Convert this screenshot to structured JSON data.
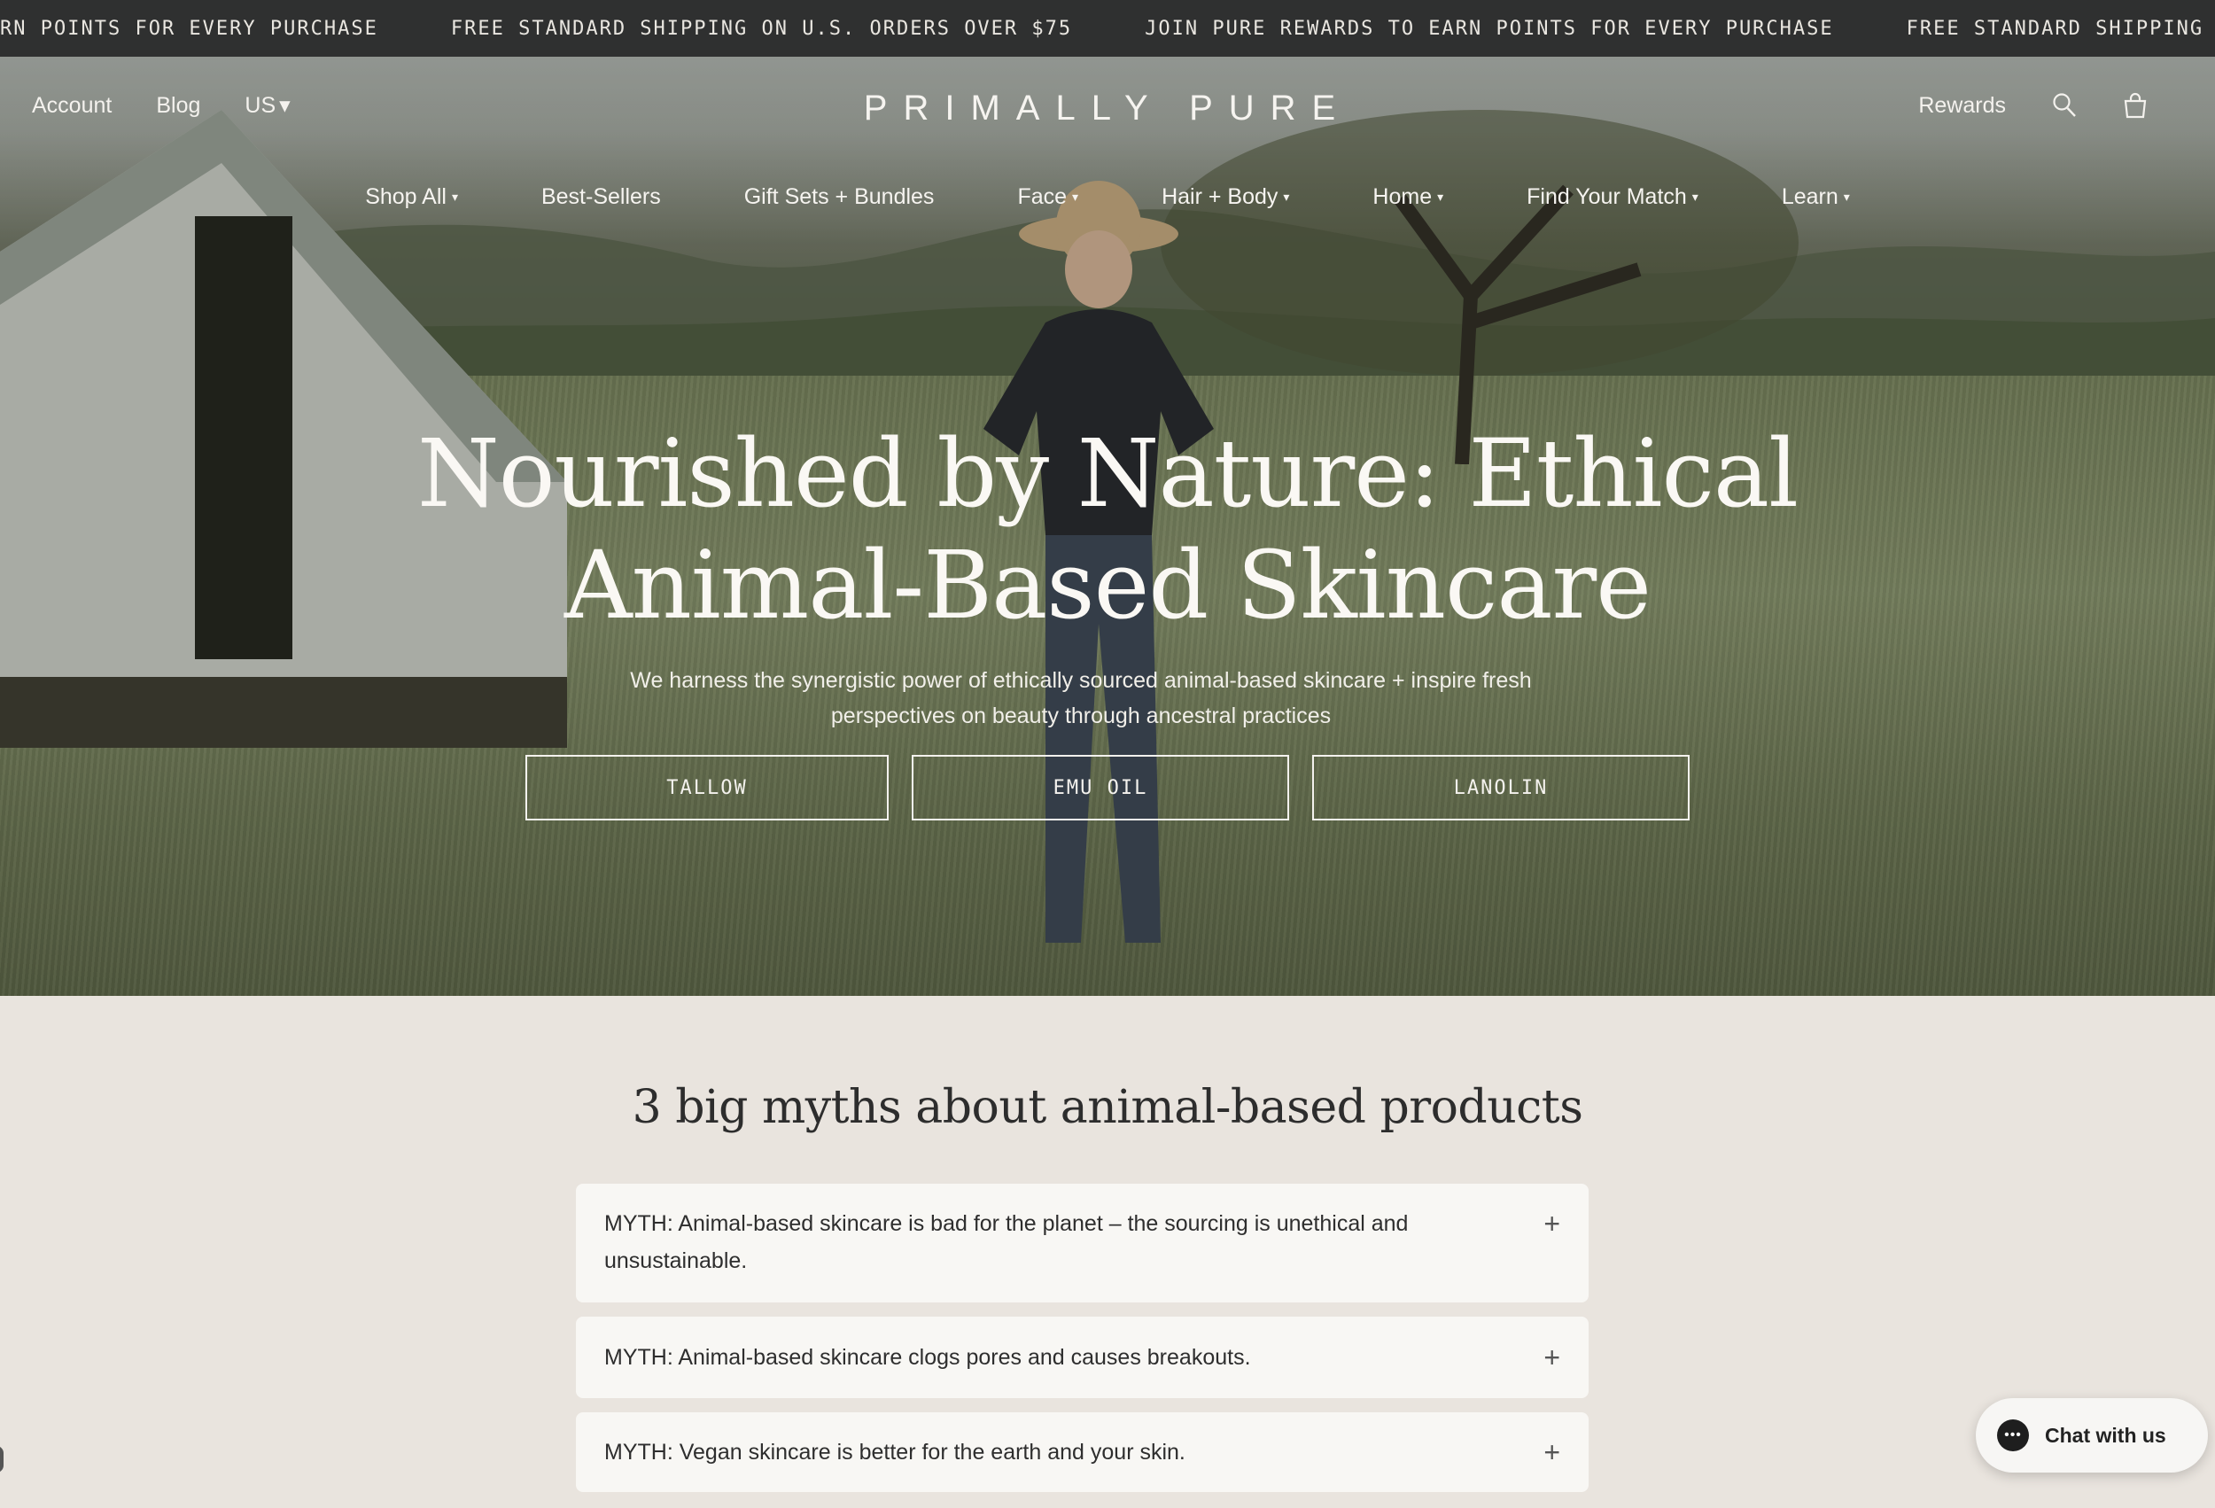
{
  "announcement": {
    "messages": [
      "RN POINTS FOR EVERY PURCHASE",
      "FREE STANDARD SHIPPING ON U.S. ORDERS OVER $75",
      "JOIN PURE REWARDS TO EARN POINTS FOR EVERY PURCHASE",
      "FREE STANDARD SHIPPING O"
    ]
  },
  "header": {
    "account": "Account",
    "blog": "Blog",
    "region": "US",
    "logo": "PRIMALLY PURE",
    "rewards": "Rewards",
    "search_icon": "search-icon",
    "cart_icon": "shopping-bag-icon"
  },
  "nav": {
    "items": [
      {
        "label": "Shop All",
        "dropdown": true
      },
      {
        "label": "Best-Sellers",
        "dropdown": false
      },
      {
        "label": "Gift Sets + Bundles",
        "dropdown": false
      },
      {
        "label": "Face",
        "dropdown": true
      },
      {
        "label": "Hair + Body",
        "dropdown": true
      },
      {
        "label": "Home",
        "dropdown": true
      },
      {
        "label": "Find Your Match",
        "dropdown": true
      },
      {
        "label": "Learn",
        "dropdown": true
      }
    ]
  },
  "hero": {
    "title_line1": "Nourished by Nature: Ethical",
    "title_line2": "Animal-Based Skincare",
    "subtitle": "We harness the synergistic power of ethically sourced animal-based skincare + inspire fresh perspectives on beauty through ancestral practices",
    "buttons": [
      "TALLOW",
      "EMU OIL",
      "LANOLIN"
    ]
  },
  "myths": {
    "title": "3 big myths about animal-based products",
    "items": [
      "MYTH: Animal-based skincare is bad for the planet – the sourcing is unethical and unsustainable.",
      "MYTH: Animal-based skincare clogs pores and causes breakouts.",
      "MYTH: Vegan skincare is better for the earth and your skin."
    ]
  },
  "chat": {
    "label": "Chat with us"
  },
  "colors": {
    "announcement_bg": "#2f3030",
    "section_bg": "#e9e4de",
    "card_bg": "#f8f7f4"
  }
}
